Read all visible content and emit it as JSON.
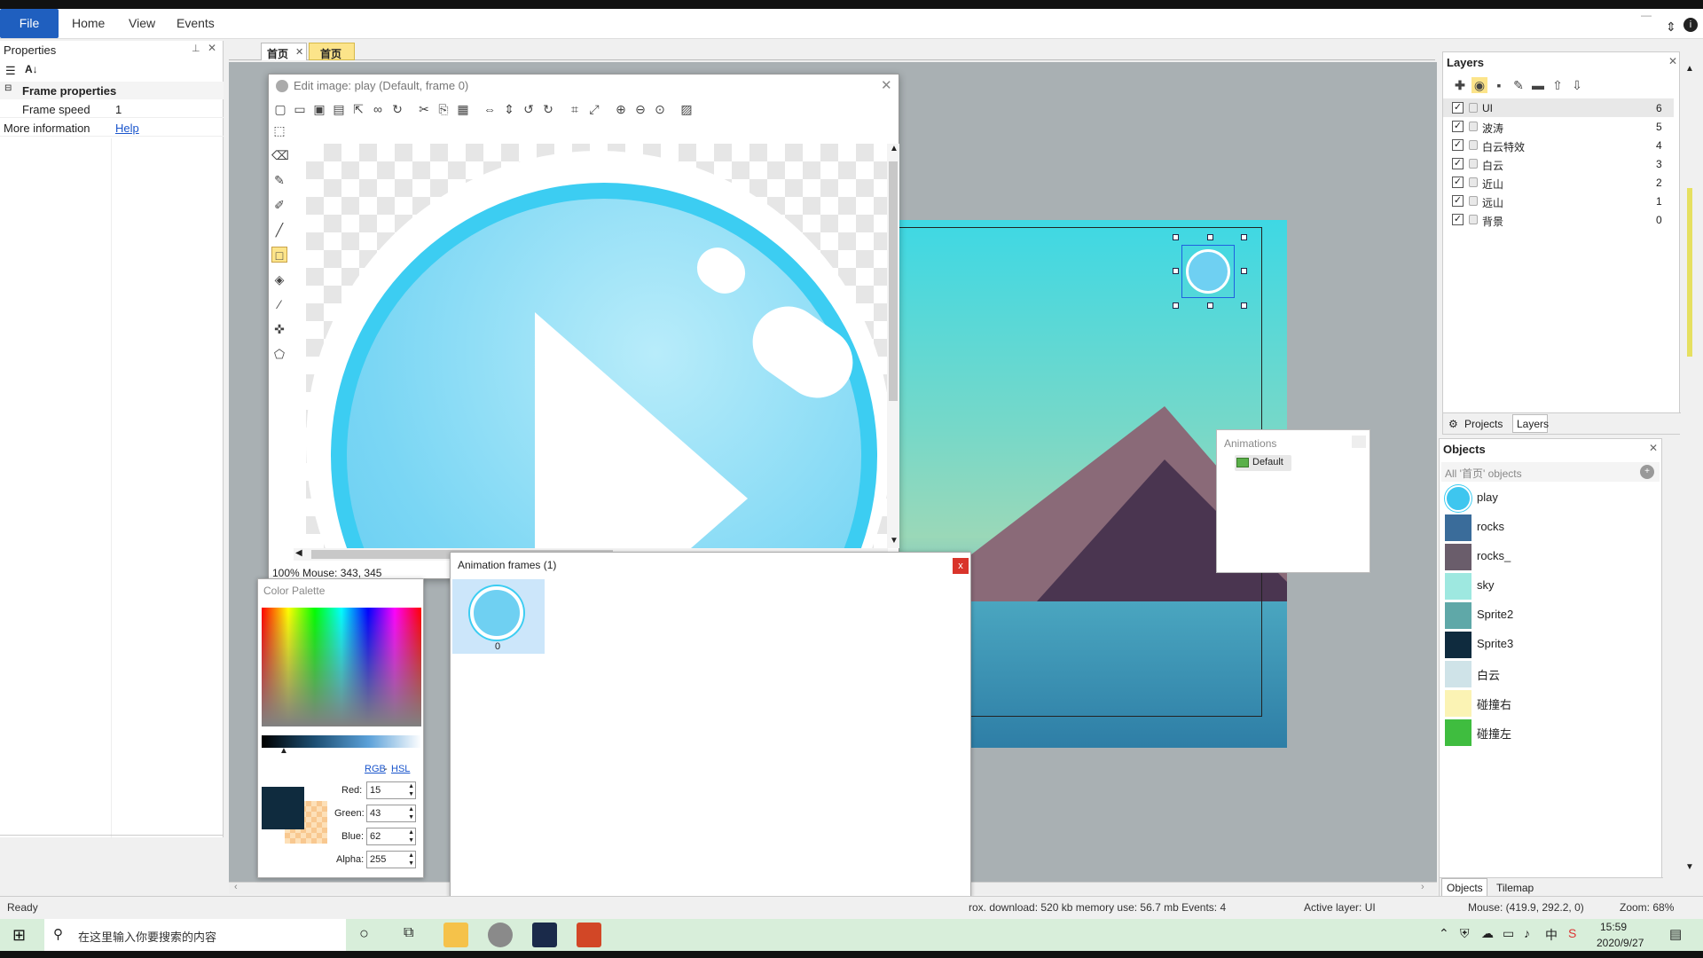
{
  "menu": {
    "file": "File",
    "home": "Home",
    "view": "View",
    "events": "Events"
  },
  "properties": {
    "title": "Properties",
    "group": "Frame properties",
    "rows": [
      {
        "label": "Frame speed",
        "value": "1"
      },
      {
        "label": "More information",
        "value": "Help"
      }
    ]
  },
  "tabs": [
    {
      "label": "首页"
    },
    {
      "label": "首页"
    }
  ],
  "edit_image": {
    "title": "Edit image: play (Default, frame 0)",
    "status": "100%  Mouse: 343, 345"
  },
  "color_palette": {
    "title": "Color Palette",
    "rgb": "RGB",
    "sep": "-",
    "hsl": "HSL",
    "red_label": "Red:",
    "red": "15",
    "green_label": "Green:",
    "green": "43",
    "blue_label": "Blue:",
    "blue": "62",
    "alpha_label": "Alpha:",
    "alpha": "255",
    "current_color": "#0f2b3e"
  },
  "animation_frames": {
    "title": "Animation frames (1)",
    "frame_index": "0"
  },
  "animations": {
    "title": "Animations",
    "items": [
      {
        "label": "Default"
      }
    ]
  },
  "layers": {
    "title": "Layers",
    "items": [
      {
        "name": "UI",
        "index": "6"
      },
      {
        "name": "波涛",
        "index": "5"
      },
      {
        "name": "白云特效",
        "index": "4"
      },
      {
        "name": "白云",
        "index": "3"
      },
      {
        "name": "近山",
        "index": "2"
      },
      {
        "name": "远山",
        "index": "1"
      },
      {
        "name": "背景",
        "index": "0"
      }
    ],
    "tab_projects": "Projects",
    "tab_layers": "Layers"
  },
  "objects": {
    "title": "Objects",
    "filter": "All '首页' objects",
    "items": [
      {
        "name": "play",
        "color": "#3ec6ef"
      },
      {
        "name": "rocks",
        "color": "#3a6c9a"
      },
      {
        "name": "rocks_",
        "color": "#6a5d6b"
      },
      {
        "name": "sky",
        "color": "#9ee8e0"
      },
      {
        "name": "Sprite2",
        "color": "#5fa8a8"
      },
      {
        "name": "Sprite3",
        "color": "#0f2b3e"
      },
      {
        "name": "白云",
        "color": "#cfe3e8"
      },
      {
        "name": "碰撞右",
        "color": "#fbf3b4"
      },
      {
        "name": "碰撞左",
        "color": "#3fbd3f"
      }
    ],
    "tab_objects": "Objects",
    "tab_tilemap": "Tilemap"
  },
  "status": {
    "ready": "Ready",
    "download": "rox. download: 520 kb  memory use: 56.7 mb  Events: 4",
    "active_layer": "Active layer: UI",
    "mouse": "Mouse: (419.9, 292.2, 0)",
    "zoom": "Zoom: 68%"
  },
  "taskbar": {
    "search": "在这里输入你要搜索的内容",
    "time": "15:59",
    "date": "2020/9/27"
  }
}
